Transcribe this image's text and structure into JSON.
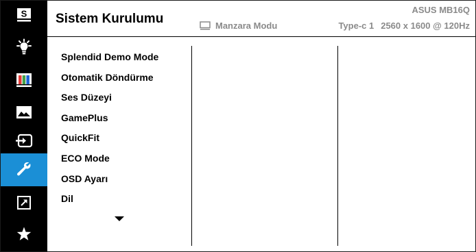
{
  "sidebar": {
    "items": [
      {
        "icon": "splendid-icon",
        "label": "S"
      },
      {
        "icon": "blue-light-icon"
      },
      {
        "icon": "color-icon"
      },
      {
        "icon": "image-icon"
      },
      {
        "icon": "input-select-icon"
      },
      {
        "icon": "system-setup-icon",
        "active": true
      },
      {
        "icon": "shortcut-icon"
      },
      {
        "icon": "favorite-star-icon"
      }
    ],
    "active_color": "#1b8fd6"
  },
  "header": {
    "title": "Sistem Kurulumu",
    "model": "ASUS MB16Q",
    "mode_icon": "landscape-monitor-icon",
    "mode": "Manzara Modu",
    "input": "Type-c 1",
    "resolution": "2560 x 1600 @ 120Hz"
  },
  "menu": {
    "items": [
      "Splendid Demo Mode",
      "Otomatik Döndürme",
      "Ses Düzeyi",
      "GamePlus",
      "QuickFit",
      "ECO Mode",
      "OSD Ayarı",
      "Dil"
    ],
    "more_icon": "down-arrow-icon"
  }
}
